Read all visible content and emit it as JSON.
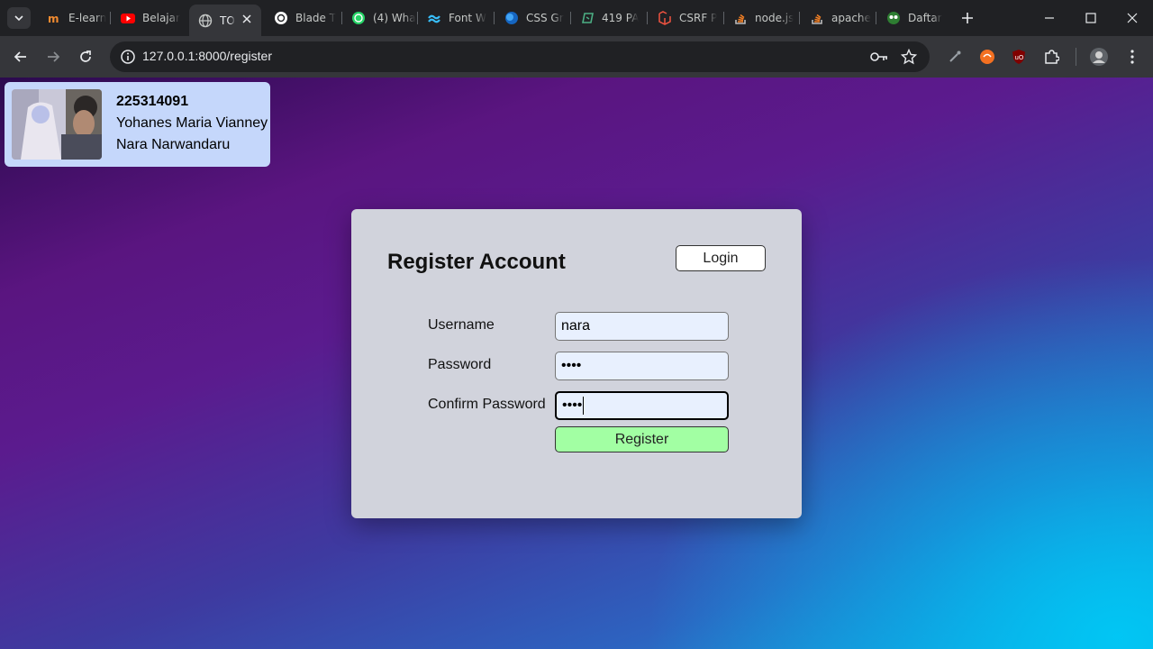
{
  "browser": {
    "tabs": [
      {
        "title": "E-learn",
        "icon": "elearning-icon"
      },
      {
        "title": "Belajar",
        "icon": "youtube-icon"
      },
      {
        "title": "TO",
        "icon": "globe-icon",
        "active": true
      },
      {
        "title": "Blade T",
        "icon": "chatgpt-icon"
      },
      {
        "title": "(4) Wha",
        "icon": "whatsapp-icon"
      },
      {
        "title": "Font W",
        "icon": "tailwind-icon"
      },
      {
        "title": "CSS Gr",
        "icon": "css-icon"
      },
      {
        "title": "419 PA",
        "icon": "code-icon"
      },
      {
        "title": "CSRF P",
        "icon": "laravel-icon"
      },
      {
        "title": "node.js",
        "icon": "stackoverflow-icon"
      },
      {
        "title": "apache",
        "icon": "stackoverflow-icon"
      },
      {
        "title": "Daftar",
        "icon": "daftar-icon"
      }
    ],
    "url": "127.0.0.1:8000/register"
  },
  "student": {
    "nim": "225314091",
    "name_line1": "Yohanes Maria Vianney",
    "name_line2": "Nara Narwandaru"
  },
  "form": {
    "title": "Register Account",
    "login_label": "Login",
    "username_label": "Username",
    "username_value": "nara",
    "password_label": "Password",
    "password_value": "••••",
    "confirm_label": "Confirm Password",
    "confirm_value": "••••",
    "register_label": "Register"
  },
  "colors": {
    "card": "#d1d3dc",
    "register_button": "#a2ffa3",
    "id_card": "#c5d7fb"
  }
}
